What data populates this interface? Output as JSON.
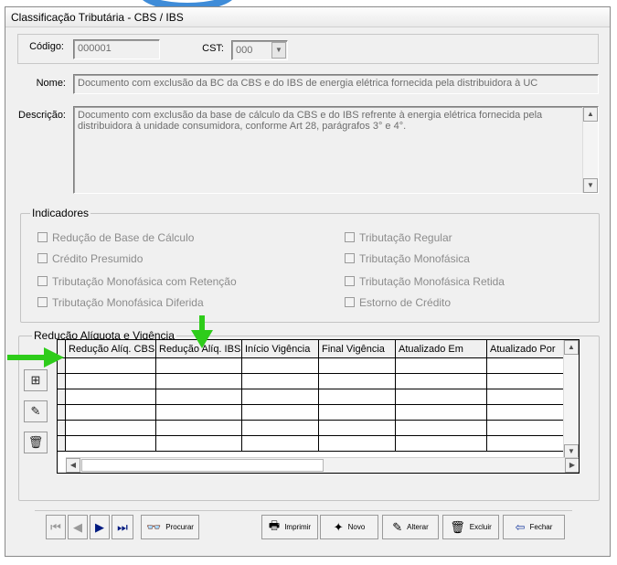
{
  "window": {
    "title": "Classificação Tributária - CBS / IBS"
  },
  "form": {
    "codigo_label": "Código:",
    "codigo_value": "000001",
    "cst_label": "CST:",
    "cst_value": "000",
    "nome_label": "Nome:",
    "nome_value": "Documento com exclusão da BC da CBS e do IBS de energia elétrica fornecida pela distribuidora à UC",
    "descricao_label": "Descrição:",
    "descricao_line1": "Documento com exclusão da base de cálculo da CBS e do IBS refrente à energia elétrica fornecida pela",
    "descricao_line2": "distribuidora à unidade consumidora, conforme Art 28, parágrafos 3° e 4°."
  },
  "indicadores": {
    "legend": "Indicadores",
    "left": [
      "Redução de Base de Cálculo",
      "Crédito Presumido",
      "Tributação Monofásica com Retenção",
      "Tributação Monofásica Diferida"
    ],
    "right": [
      "Tributação Regular",
      "Tributação Monofásica",
      "Tributação Monofásica Retida",
      "Estorno de Crédito"
    ]
  },
  "reducao": {
    "legend": "Redução Alíquota e Vigência",
    "columns": [
      "Redução Alíq. CBS",
      "Redução Alíq. IBS",
      "Início Vigência",
      "Final Vigência",
      "Atualizado Em",
      "Atualizado Por"
    ]
  },
  "toolbar": {
    "procurar": "Procurar",
    "imprimir": "Imprimir",
    "novo": "Novo",
    "alterar": "Alterar",
    "excluir": "Excluir",
    "fechar": "Fechar"
  },
  "colors": {
    "annotation_arrow": "#2ecc1a",
    "window_bg": "#f0f0f0",
    "disabled_text": "#8c8c8c"
  }
}
